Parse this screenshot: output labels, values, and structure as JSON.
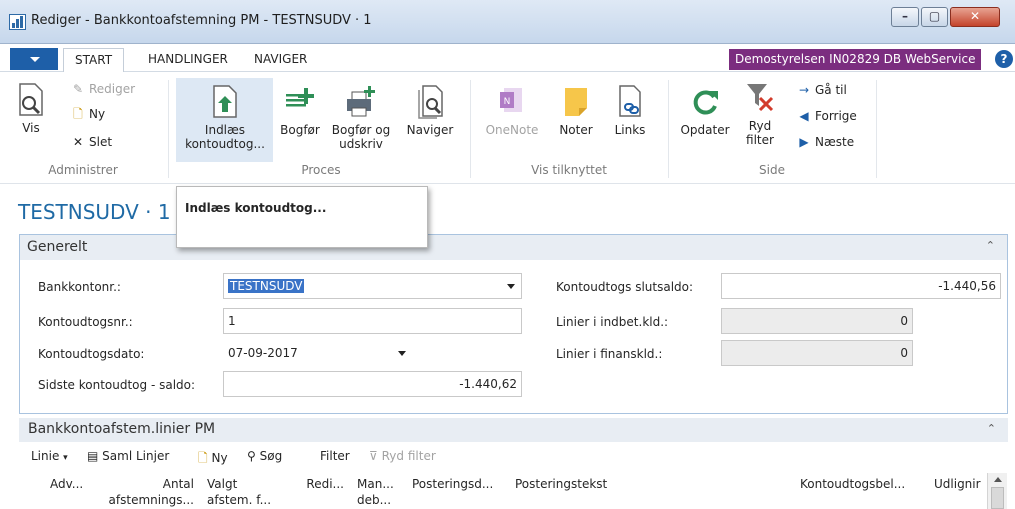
{
  "window": {
    "title": "Rediger - Bankkontoafstemning PM - TESTNSUDV · 1"
  },
  "ribbon_tabs": [
    {
      "label": "START",
      "active": true
    },
    {
      "label": "HANDLINGER",
      "active": false
    },
    {
      "label": "NAVIGER",
      "active": false
    }
  ],
  "company_badge": "Demostyrelsen IN02829 DB WebService",
  "help_glyph": "?",
  "ribbon": {
    "administrer": {
      "label": "Administrer",
      "vis": "Vis",
      "rediger": "Rediger",
      "ny": "Ny",
      "slet": "Slet"
    },
    "proces": {
      "label": "Proces",
      "indlaes_line1": "Indlæs",
      "indlaes_line2": "kontoudtog...",
      "bogfor": "Bogfør",
      "bogfor_udskriv_line1": "Bogfør og",
      "bogfor_udskriv_line2": "udskriv",
      "naviger": "Naviger"
    },
    "vis_tilknyttet": {
      "label": "Vis tilknyttet",
      "onenote": "OneNote",
      "noter": "Noter",
      "links": "Links"
    },
    "side": {
      "label": "Side",
      "opdater": "Opdater",
      "ryd_filter_line1": "Ryd",
      "ryd_filter_line2": "filter",
      "gaa_til": "Gå til",
      "forrige": "Forrige",
      "naeste": "Næste"
    }
  },
  "tooltip": {
    "title": "Indlæs kontoudtog..."
  },
  "page_title": "TESTNSUDV · 1",
  "generelt": {
    "header": "Generelt",
    "fields_left": [
      {
        "label": "Bankkontonr.:",
        "value": "TESTNSUDV"
      },
      {
        "label": "Kontoudtogsnr.:",
        "value": "1"
      },
      {
        "label": "Kontoudtogsdato:",
        "value": "07-09-2017"
      },
      {
        "label": "Sidste kontoudtog - saldo:",
        "value": "-1.440,62"
      }
    ],
    "fields_right": [
      {
        "label": "Kontoudtogs slutsaldo:",
        "value": "-1.440,56"
      },
      {
        "label": "Linier i indbet.kld.:",
        "value": "0"
      },
      {
        "label": "Linier i finanskld.:",
        "value": "0"
      }
    ]
  },
  "lines": {
    "header": "Bankkontoafstem.linier PM",
    "toolbar": {
      "linie": "Linie",
      "saml_linjer": "Saml Linjer",
      "ny": "Ny",
      "soeg": "Søg",
      "filter": "Filter",
      "ryd_filter": "Ryd filter"
    },
    "columns": [
      {
        "line1": "Adv...",
        "line2": ""
      },
      {
        "line1": "Antal",
        "line2": "afstemnings..."
      },
      {
        "line1": "Valgt",
        "line2": "afstem. f..."
      },
      {
        "line1": "Redi...",
        "line2": ""
      },
      {
        "line1": "Man...",
        "line2": "deb..."
      },
      {
        "line1": "Posteringsd...",
        "line2": ""
      },
      {
        "line1": "Posteringstekst",
        "line2": ""
      },
      {
        "line1": "Kontoudtogsbel...",
        "line2": ""
      },
      {
        "line1": "Udlignir",
        "line2": ""
      }
    ]
  },
  "colors": {
    "accent": "#1f6aa5",
    "company_badge": "#7b2d7f",
    "selection": "#3a73c7",
    "section_border": "#a9c3df"
  }
}
